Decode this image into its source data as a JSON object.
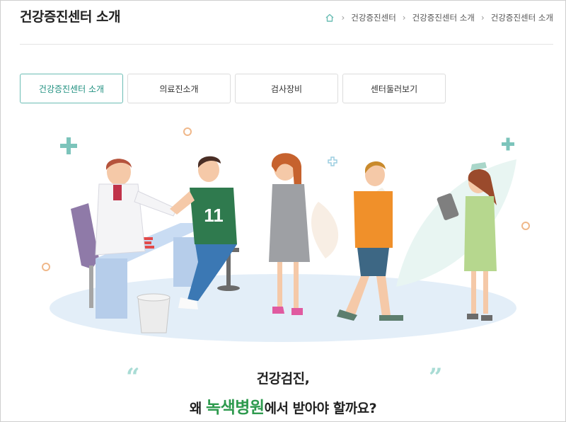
{
  "page_title": "건강증진센터 소개",
  "breadcrumb": {
    "home_icon": "home-icon",
    "items": [
      "건강증진센터",
      "건강증진센터 소개",
      "건강증진센터 소개"
    ]
  },
  "tabs": [
    {
      "label": "건강증진센터 소개",
      "active": true
    },
    {
      "label": "의료진소개",
      "active": false
    },
    {
      "label": "검사장비",
      "active": false
    },
    {
      "label": "센터둘러보기",
      "active": false
    }
  ],
  "headline": {
    "line1": "건강검진,",
    "line2_prefix": "왜 ",
    "line2_accent": "녹색병원",
    "line2_suffix": "에서 받아야 할까요?",
    "open_quote": "“",
    "close_quote": "”"
  },
  "illustration": {
    "player_number": "11",
    "colors": {
      "accent_teal": "#6bbdb4",
      "accent_green": "#2e9a4e"
    }
  }
}
